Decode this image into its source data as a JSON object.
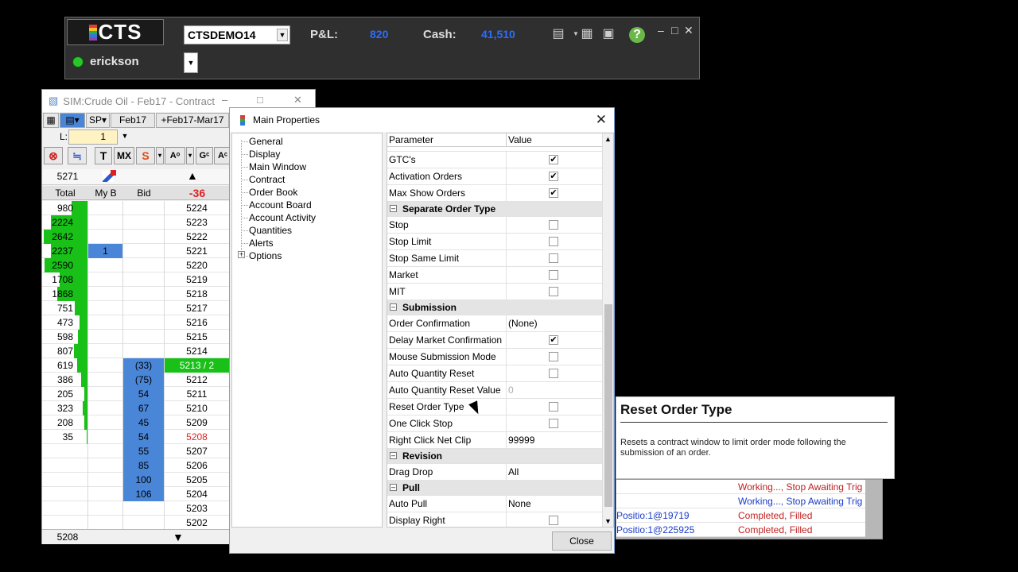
{
  "toolbar": {
    "logo_text": "CTS",
    "account": "CTSDEMO14",
    "pnl_label": "P&L:",
    "pnl_value": "820",
    "cash_label": "Cash:",
    "cash_value": "41,510",
    "username": "erickson",
    "icons": [
      "order-ticket-icon",
      "building-icon",
      "save-icon",
      "help-icon"
    ]
  },
  "contract": {
    "title": "SIM:Crude Oil - Feb17 - Contract",
    "route": "SP",
    "month": "Feb17",
    "spread": "+Feb17-Mar17",
    "qty_label": "L:",
    "qty_value": "1",
    "tools": [
      "T",
      "MX",
      "S"
    ],
    "last_price": "5271",
    "headers": {
      "total": "Total",
      "myb": "My B",
      "bid": "Bid",
      "net": "-36"
    },
    "rows": [
      {
        "total": "980",
        "bar": 0.35,
        "myb": "",
        "bid": "",
        "price": "5224"
      },
      {
        "total": "2224",
        "bar": 0.8,
        "myb": "",
        "bid": "",
        "price": "5223"
      },
      {
        "total": "2642",
        "bar": 0.95,
        "myb": "",
        "bid": "",
        "price": "5222"
      },
      {
        "total": "2237",
        "bar": 0.8,
        "myb": "1",
        "bid": "",
        "price": "5221"
      },
      {
        "total": "2590",
        "bar": 0.93,
        "myb": "",
        "bid": "",
        "price": "5220"
      },
      {
        "total": "1708",
        "bar": 0.6,
        "myb": "",
        "bid": "",
        "price": "5219"
      },
      {
        "total": "1868",
        "bar": 0.66,
        "myb": "",
        "bid": "",
        "price": "5218"
      },
      {
        "total": "751",
        "bar": 0.27,
        "myb": "",
        "bid": "",
        "price": "5217"
      },
      {
        "total": "473",
        "bar": 0.17,
        "myb": "",
        "bid": "",
        "price": "5216"
      },
      {
        "total": "598",
        "bar": 0.21,
        "myb": "",
        "bid": "",
        "price": "5215"
      },
      {
        "total": "807",
        "bar": 0.29,
        "myb": "",
        "bid": "",
        "price": "5214"
      },
      {
        "total": "619",
        "bar": 0.22,
        "myb": "",
        "bid": "(33)",
        "price": "5213 / 2",
        "price_style": "green"
      },
      {
        "total": "386",
        "bar": 0.14,
        "myb": "",
        "bid": "(75)",
        "price": "5212"
      },
      {
        "total": "205",
        "bar": 0.07,
        "myb": "",
        "bid": "54",
        "price": "5211"
      },
      {
        "total": "323",
        "bar": 0.11,
        "myb": "",
        "bid": "67",
        "price": "5210"
      },
      {
        "total": "208",
        "bar": 0.07,
        "myb": "",
        "bid": "45",
        "price": "5209"
      },
      {
        "total": "35",
        "bar": 0.02,
        "myb": "",
        "bid": "54",
        "price": "5208",
        "price_style": "red"
      },
      {
        "total": "",
        "bar": 0,
        "myb": "",
        "bid": "55",
        "price": "5207"
      },
      {
        "total": "",
        "bar": 0,
        "myb": "",
        "bid": "85",
        "price": "5206"
      },
      {
        "total": "",
        "bar": 0,
        "myb": "",
        "bid": "100",
        "price": "5205"
      },
      {
        "total": "",
        "bar": 0,
        "myb": "",
        "bid": "106",
        "price": "5204"
      },
      {
        "total": "",
        "bar": 0,
        "myb": "",
        "bid": "",
        "price": "5203"
      },
      {
        "total": "",
        "bar": 0,
        "myb": "",
        "bid": "",
        "price": "5202"
      }
    ],
    "footer_price": "5208"
  },
  "dialog": {
    "title": "Main Properties",
    "tree": [
      "General",
      "Display",
      "Main Window",
      "Contract",
      "Order Book",
      "Account Board",
      "Account Activity",
      "Quantities",
      "Alerts",
      "Options"
    ],
    "grid_headers": {
      "param": "Parameter",
      "value": "Value"
    },
    "rows": [
      {
        "type": "row",
        "p": "GTC's",
        "check": true
      },
      {
        "type": "row",
        "p": "Activation Orders",
        "check": true
      },
      {
        "type": "row",
        "p": "Max Show Orders",
        "check": true
      },
      {
        "type": "cat",
        "p": "Separate Order Type"
      },
      {
        "type": "row",
        "p": "Stop",
        "check": false
      },
      {
        "type": "row",
        "p": "Stop Limit",
        "check": false
      },
      {
        "type": "row",
        "p": "Stop Same Limit",
        "check": false
      },
      {
        "type": "row",
        "p": "Market",
        "check": false
      },
      {
        "type": "row",
        "p": "MIT",
        "check": false
      },
      {
        "type": "cat",
        "p": "Submission"
      },
      {
        "type": "row",
        "p": "Order Confirmation",
        "v": "(None)"
      },
      {
        "type": "row",
        "p": "Delay Market Confirmation",
        "check": true
      },
      {
        "type": "row",
        "p": "Mouse Submission Mode",
        "check": false
      },
      {
        "type": "row",
        "p": "Auto Quantity Reset",
        "check": false
      },
      {
        "type": "row",
        "p": "Auto Quantity Reset Value",
        "v": "0",
        "disabled": true
      },
      {
        "type": "row",
        "p": "Reset Order Type",
        "check": false
      },
      {
        "type": "row",
        "p": "One Click Stop",
        "check": false
      },
      {
        "type": "row",
        "p": "Right Click Net Clip",
        "v": "99999"
      },
      {
        "type": "cat",
        "p": "Revision"
      },
      {
        "type": "row",
        "p": "Drag Drop",
        "v": "All"
      },
      {
        "type": "cat",
        "p": "Pull"
      },
      {
        "type": "row",
        "p": "Auto Pull",
        "v": "None"
      },
      {
        "type": "row",
        "p": "Display Right",
        "check": false
      }
    ],
    "close_label": "Close"
  },
  "tooltip": {
    "title": "Reset Order Type",
    "body": "Resets a contract window to limit order mode following the submission of an order."
  },
  "orders": [
    {
      "name": "",
      "status": "Working..., Stop Awaiting Trig",
      "color": "#c02020"
    },
    {
      "name": "",
      "status": "Working..., Stop Awaiting Trig",
      "color": "#1a3cc8"
    },
    {
      "name": "Positio:1@19719",
      "status": "Completed, Filled",
      "color": "#c02020"
    },
    {
      "name": "Positio:1@225925",
      "status": "Completed, Filled",
      "color": "#c02020"
    }
  ]
}
